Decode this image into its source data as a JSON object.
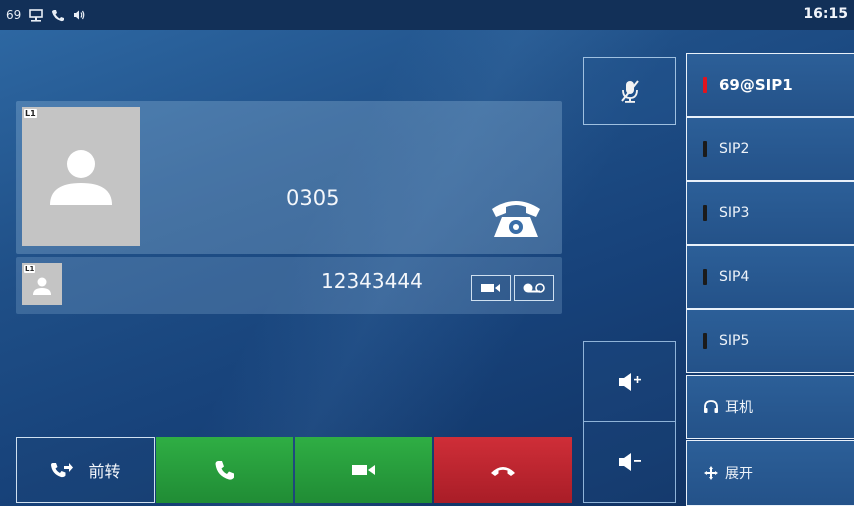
{
  "status_bar": {
    "extension": "69",
    "time": "16:15",
    "icons": [
      "network-icon",
      "phone-icon",
      "volume-icon"
    ]
  },
  "call": {
    "line_label": "L1",
    "remote_number": "0305",
    "state_icon": "ringing-phone-icon",
    "second_line_label": "L1",
    "second_number": "12343444",
    "second_actions": [
      "video-icon",
      "voicemail-icon"
    ]
  },
  "mute": {
    "icon": "mute-mic-icon"
  },
  "volume": {
    "up_icon": "volume-up-icon",
    "down_icon": "volume-down-icon"
  },
  "accounts": [
    {
      "label": "69@SIP1",
      "status_color": "#e0141f",
      "active": true
    },
    {
      "label": "SIP2",
      "status_color": "#1b1b1b",
      "active": false
    },
    {
      "label": "SIP3",
      "status_color": "#1b1b1b",
      "active": false
    },
    {
      "label": "SIP4",
      "status_color": "#1b1b1b",
      "active": false
    },
    {
      "label": "SIP5",
      "status_color": "#1b1b1b",
      "active": false
    }
  ],
  "functions": {
    "headset_label": "耳机",
    "expand_label": "展开"
  },
  "bottom": {
    "forward_label": "前转",
    "answer_icon": "handset-icon",
    "video_icon": "video-camera-icon",
    "reject_icon": "hangup-icon",
    "answer_color": "#2fae44",
    "reject_color": "#cf2e38"
  }
}
